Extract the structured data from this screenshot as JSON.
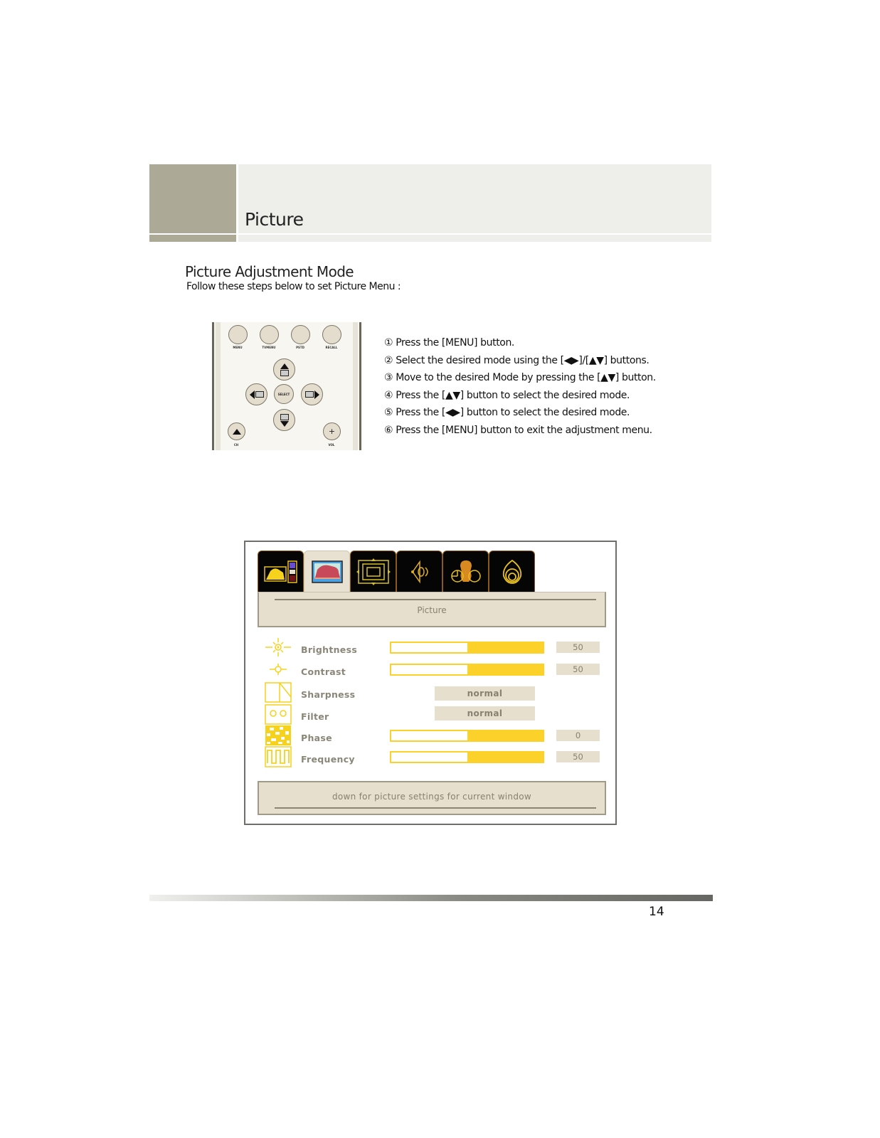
{
  "header": {
    "title": "Picture"
  },
  "section": {
    "title": "Picture Adjustment Mode",
    "subtitle": "Follow these steps below to set Picture Menu :"
  },
  "remote": {
    "top_buttons": [
      {
        "label": "MENU"
      },
      {
        "label": "TVMENU"
      },
      {
        "label": "PSTD"
      },
      {
        "label": "RECALL"
      }
    ],
    "center_button": "SELECT",
    "ch_label": "CH",
    "vol_label": "VOL",
    "vol_plus": "+"
  },
  "steps": [
    "① Press the [MENU] button.",
    "② Select the desired mode using the [◀▶]/[▲▼] buttons.",
    "③ Move to the desired Mode by pressing the [▲▼] button.",
    "④ Press the [▲▼] button to select the desired mode.",
    "⑤ Press the [◀▶] button to select the desired mode.",
    "⑥ Press the [MENU] button to exit the adjustment menu."
  ],
  "osd": {
    "tabs": [
      {
        "name": "input-source",
        "icon": "input-source-icon",
        "active": false
      },
      {
        "name": "picture",
        "icon": "picture-icon",
        "active": true
      },
      {
        "name": "screen-size",
        "icon": "screen-size-icon",
        "active": false
      },
      {
        "name": "audio",
        "icon": "speaker-icon",
        "active": false
      },
      {
        "name": "features",
        "icon": "features-icon",
        "active": false
      },
      {
        "name": "settings",
        "icon": "settings-icon",
        "active": false
      }
    ],
    "title": "Picture",
    "rows": [
      {
        "label": "Brightness",
        "type": "slider",
        "value": "50",
        "fill_percent": 50,
        "icon": "brightness-icon"
      },
      {
        "label": "Contrast",
        "type": "slider",
        "value": "50",
        "fill_percent": 50,
        "icon": "contrast-icon"
      },
      {
        "label": "Sharpness",
        "type": "select",
        "value": "normal",
        "icon": "sharpness-icon"
      },
      {
        "label": "Filter",
        "type": "select",
        "value": "normal",
        "icon": "filter-icon"
      },
      {
        "label": "Phase",
        "type": "slider",
        "value": "0",
        "fill_percent": 50,
        "icon": "phase-icon"
      },
      {
        "label": "Frequency",
        "type": "slider",
        "value": "50",
        "fill_percent": 50,
        "icon": "frequency-icon"
      }
    ],
    "hint": "down for picture settings for current window",
    "colors": {
      "accent": "#fcd22a",
      "panel": "#e7dfcd",
      "text": "#888070",
      "tab_bg": "#050505"
    }
  },
  "footer": {
    "page_number": "14"
  }
}
